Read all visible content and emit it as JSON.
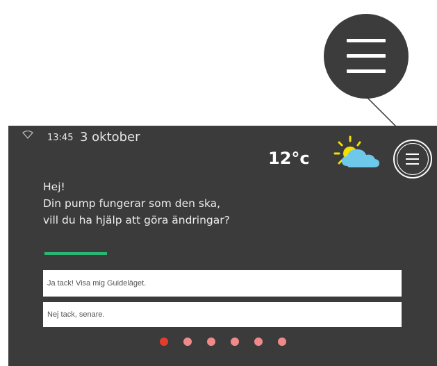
{
  "status_bar": {
    "time": "13:45",
    "date": "3 oktober",
    "icons": [
      "wifi-icon"
    ]
  },
  "weather": {
    "temperature": "12°c",
    "icon": "partly-sunny-icon"
  },
  "menu": {
    "icon": "hamburger-menu-icon"
  },
  "message": {
    "lines": [
      "Hej!",
      "Din pump fungerar som den ska,",
      "vill du ha hjälp att göra ändringar?"
    ]
  },
  "progress": {
    "fraction": 0.17,
    "color": "#2bb673"
  },
  "options": [
    {
      "label": "Ja tack! Visa mig Guideläget."
    },
    {
      "label": "Nej tack, senare."
    }
  ],
  "pager": {
    "count": 6,
    "active_index": 0,
    "active_color": "#e63c2e",
    "inactive_color": "#f08a8a"
  },
  "colors": {
    "screen_bg": "#3b3b3b",
    "callout_bg": "#3c3c3c",
    "text": "#ededed"
  }
}
